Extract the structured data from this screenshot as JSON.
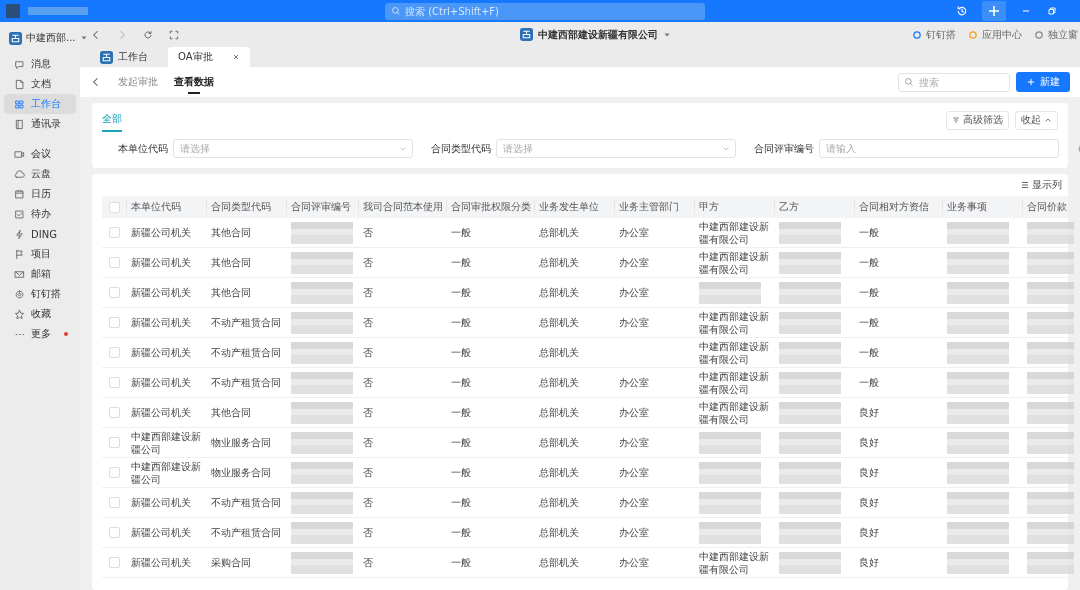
{
  "titlebar": {
    "search_placeholder": "搜索 (Ctrl+Shift+F)"
  },
  "org_switcher": {
    "name": "中建西部..."
  },
  "toolbar": {
    "company": "中建西部建设新疆有限公司",
    "links": [
      "钉钉搭",
      "应用中心",
      "独立窗"
    ]
  },
  "sidebar": {
    "items": [
      {
        "label": "消息",
        "selected": false,
        "badge": false
      },
      {
        "label": "文档",
        "selected": false,
        "badge": false
      },
      {
        "label": "工作台",
        "selected": true,
        "badge": false
      },
      {
        "label": "通讯录",
        "selected": false,
        "badge": false
      },
      {
        "label": "会议",
        "selected": false,
        "badge": false
      },
      {
        "label": "云盘",
        "selected": false,
        "badge": false
      },
      {
        "label": "日历",
        "selected": false,
        "badge": false
      },
      {
        "label": "待办",
        "selected": false,
        "badge": false
      },
      {
        "label": "DING",
        "selected": false,
        "badge": false
      },
      {
        "label": "项目",
        "selected": false,
        "badge": false
      },
      {
        "label": "邮箱",
        "selected": false,
        "badge": false
      },
      {
        "label": "钉钉搭",
        "selected": false,
        "badge": false
      },
      {
        "label": "收藏",
        "selected": false,
        "badge": false
      },
      {
        "label": "更多",
        "selected": false,
        "badge": true
      }
    ]
  },
  "tabs": [
    {
      "label": "工作台",
      "selected": false,
      "closable": false
    },
    {
      "label": "OA审批",
      "selected": true,
      "closable": true
    }
  ],
  "subnav": {
    "items": [
      {
        "label": "发起审批",
        "selected": false
      },
      {
        "label": "查看数据",
        "selected": true
      }
    ],
    "search_placeholder": "搜索",
    "new_button": "新建"
  },
  "filters": {
    "tabs": [
      {
        "label": "全部",
        "selected": true
      }
    ],
    "advanced": "高级筛选",
    "collapse": "收起",
    "fields": [
      {
        "label": "本单位代码",
        "placeholder": "请选择",
        "kind": "select"
      },
      {
        "label": "合同类型代码",
        "placeholder": "请选择",
        "kind": "select"
      },
      {
        "label": "合同评审编号",
        "placeholder": "请输入",
        "kind": "input"
      }
    ]
  },
  "table": {
    "columns_button": "显示列",
    "all_checked": false,
    "columns": [
      "本单位代码",
      "合同类型代码",
      "合同评审编号",
      "我司合同范本使用",
      "合同审批权限分类",
      "业务发生单位",
      "业务主管部门",
      "甲方",
      "乙方",
      "合同相对方资信",
      "业务事项",
      "合同价款"
    ],
    "rows": [
      {
        "checked": false,
        "cells": [
          {
            "text": "新疆公司机关"
          },
          {
            "text": "其他合同"
          },
          {
            "blurred": true
          },
          {
            "text": "否"
          },
          {
            "text": "一般"
          },
          {
            "text": "总部机关"
          },
          {
            "text": "办公室"
          },
          {
            "text": "中建西部建设新疆有限公司"
          },
          {
            "blurred": true
          },
          {
            "text": "一般"
          },
          {
            "blurred": true
          },
          {
            "blurred": true
          }
        ]
      },
      {
        "checked": false,
        "cells": [
          {
            "text": "新疆公司机关"
          },
          {
            "text": "其他合同"
          },
          {
            "blurred": true
          },
          {
            "text": "否"
          },
          {
            "text": "一般"
          },
          {
            "text": "总部机关"
          },
          {
            "text": "办公室"
          },
          {
            "text": "中建西部建设新疆有限公司"
          },
          {
            "blurred": true
          },
          {
            "text": "一般"
          },
          {
            "blurred": true
          },
          {
            "blurred": true
          }
        ]
      },
      {
        "checked": false,
        "cells": [
          {
            "text": "新疆公司机关"
          },
          {
            "text": "其他合同"
          },
          {
            "blurred": true
          },
          {
            "text": "否"
          },
          {
            "text": "一般"
          },
          {
            "text": "总部机关"
          },
          {
            "text": "办公室"
          },
          {
            "blurred": true
          },
          {
            "blurred": true
          },
          {
            "text": "一般"
          },
          {
            "blurred": true
          },
          {
            "blurred": true
          }
        ]
      },
      {
        "checked": false,
        "cells": [
          {
            "text": "新疆公司机关"
          },
          {
            "text": "不动产租赁合同"
          },
          {
            "blurred": true
          },
          {
            "text": "否"
          },
          {
            "text": "一般"
          },
          {
            "text": "总部机关"
          },
          {
            "text": "办公室"
          },
          {
            "text": "中建西部建设新疆有限公司"
          },
          {
            "blurred": true
          },
          {
            "text": "一般"
          },
          {
            "blurred": true
          },
          {
            "blurred": true
          }
        ]
      },
      {
        "checked": false,
        "cells": [
          {
            "text": "新疆公司机关"
          },
          {
            "text": "不动产租赁合同"
          },
          {
            "blurred": true
          },
          {
            "text": "否"
          },
          {
            "text": "一般"
          },
          {
            "text": "总部机关"
          },
          {},
          {
            "text": "中建西部建设新疆有限公司"
          },
          {
            "blurred": true
          },
          {
            "text": "一般"
          },
          {
            "blurred": true
          },
          {
            "blurred": true
          }
        ]
      },
      {
        "checked": false,
        "cells": [
          {
            "text": "新疆公司机关"
          },
          {
            "text": "不动产租赁合同"
          },
          {
            "blurred": true
          },
          {
            "text": "否"
          },
          {
            "text": "一般"
          },
          {
            "text": "总部机关"
          },
          {
            "text": "办公室"
          },
          {
            "text": "中建西部建设新疆有限公司"
          },
          {
            "blurred": true
          },
          {
            "text": "一般"
          },
          {
            "blurred": true
          },
          {
            "blurred": true
          }
        ]
      },
      {
        "checked": false,
        "cells": [
          {
            "text": "新疆公司机关"
          },
          {
            "text": "其他合同"
          },
          {
            "blurred": true
          },
          {
            "text": "否"
          },
          {
            "text": "一般"
          },
          {
            "text": "总部机关"
          },
          {
            "text": "办公室"
          },
          {
            "text": "中建西部建设新疆有限公司"
          },
          {
            "blurred": true
          },
          {
            "text": "良好"
          },
          {
            "blurred": true
          },
          {
            "blurred": true
          }
        ]
      },
      {
        "checked": false,
        "cells": [
          {
            "text": "中建西部建设新疆公司"
          },
          {
            "text": "物业服务合同"
          },
          {
            "blurred": true
          },
          {
            "text": "否"
          },
          {
            "text": "一般"
          },
          {
            "text": "总部机关"
          },
          {
            "text": "办公室"
          },
          {
            "blurred": true
          },
          {
            "blurred": true
          },
          {
            "text": "良好"
          },
          {
            "blurred": true
          },
          {
            "blurred": true
          }
        ]
      },
      {
        "checked": false,
        "cells": [
          {
            "text": "中建西部建设新疆公司"
          },
          {
            "text": "物业服务合同"
          },
          {
            "blurred": true
          },
          {
            "text": "否"
          },
          {
            "text": "一般"
          },
          {
            "text": "总部机关"
          },
          {
            "text": "办公室"
          },
          {
            "blurred": true
          },
          {
            "blurred": true
          },
          {
            "text": "良好"
          },
          {
            "blurred": true
          },
          {
            "blurred": true
          }
        ]
      },
      {
        "checked": false,
        "cells": [
          {
            "text": "新疆公司机关"
          },
          {
            "text": "不动产租赁合同"
          },
          {
            "blurred": true
          },
          {
            "text": "否"
          },
          {
            "text": "一般"
          },
          {
            "text": "总部机关"
          },
          {
            "text": "办公室"
          },
          {
            "blurred": true
          },
          {
            "blurred": true
          },
          {
            "text": "良好"
          },
          {
            "blurred": true
          },
          {
            "blurred": true
          }
        ]
      },
      {
        "checked": false,
        "cells": [
          {
            "text": "新疆公司机关"
          },
          {
            "text": "不动产租赁合同"
          },
          {
            "blurred": true
          },
          {
            "text": "否"
          },
          {
            "text": "一般"
          },
          {
            "text": "总部机关"
          },
          {
            "text": "办公室"
          },
          {
            "blurred": true
          },
          {
            "blurred": true
          },
          {
            "text": "良好"
          },
          {
            "blurred": true
          },
          {
            "blurred": true
          }
        ]
      },
      {
        "checked": false,
        "cells": [
          {
            "text": "新疆公司机关"
          },
          {
            "text": "采购合同"
          },
          {
            "blurred": true
          },
          {
            "text": "否"
          },
          {
            "text": "一般"
          },
          {
            "text": "总部机关"
          },
          {
            "text": "办公室"
          },
          {
            "text": "中建西部建设新疆有限公司"
          },
          {
            "blurred": true
          },
          {
            "text": "良好"
          },
          {
            "blurred": true
          },
          {
            "blurred": true
          }
        ]
      }
    ]
  }
}
